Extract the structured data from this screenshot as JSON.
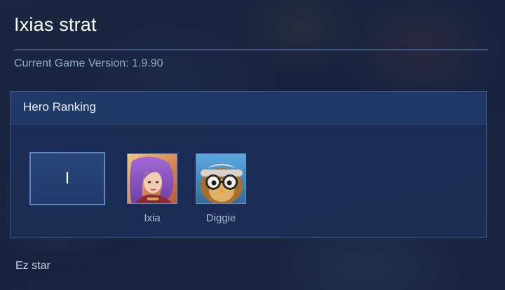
{
  "page": {
    "title": "Ixias strat",
    "version": "Current Game Version: 1.9.90",
    "footer_text": "Ez star"
  },
  "ranking": {
    "title": "Hero Ranking",
    "tier_label": "I",
    "heroes": [
      {
        "name": "Ixia",
        "portrait_icon": "ixia-portrait"
      },
      {
        "name": "Diggie",
        "portrait_icon": "diggie-portrait"
      }
    ]
  },
  "colors": {
    "panel": "#1c2e56",
    "panel_header": "#223a68",
    "tier_border": "#5e86c4",
    "version_text": "#8fa9c9"
  }
}
